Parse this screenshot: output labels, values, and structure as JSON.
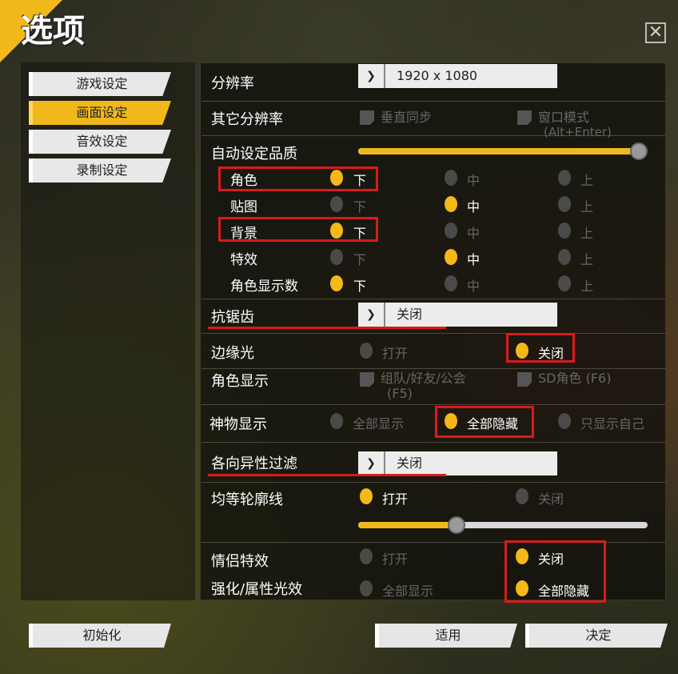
{
  "window": {
    "title": "选项"
  },
  "sidebar": {
    "items": [
      {
        "label": "游戏设定"
      },
      {
        "label": "画面设定"
      },
      {
        "label": "音效设定"
      },
      {
        "label": "录制设定"
      }
    ]
  },
  "settings": {
    "resolution": {
      "label": "分辨率",
      "value": "1920 x 1080"
    },
    "other_resolution": {
      "label": "其它分辨率",
      "vsync": "垂直同步",
      "window_mode": "窗口模式",
      "window_mode_hint": "(Alt+Enter)"
    },
    "auto_quality": {
      "label": "自动设定品质",
      "level": 0.97
    },
    "quality_rows": [
      {
        "label": "角色",
        "low": "下",
        "mid": "中",
        "high": "上",
        "selected": "low"
      },
      {
        "label": "贴图",
        "low": "下",
        "mid": "中",
        "high": "上",
        "selected": "mid"
      },
      {
        "label": "背景",
        "low": "下",
        "mid": "中",
        "high": "上",
        "selected": "low"
      },
      {
        "label": "特效",
        "low": "下",
        "mid": "中",
        "high": "上",
        "selected": "mid"
      },
      {
        "label": "角色显示数",
        "low": "下",
        "mid": "中",
        "high": "上",
        "selected": "low"
      }
    ],
    "antialias": {
      "label": "抗锯齿",
      "value": "关闭"
    },
    "rim_light": {
      "label": "边缘光",
      "on": "打开",
      "off": "关闭",
      "selected": "off"
    },
    "char_display": {
      "label": "角色显示",
      "opt1": "组队/好友/公会",
      "opt1_hint": "(F5)",
      "opt2": "SD角色 (F6)"
    },
    "artifact": {
      "label": "神物显示",
      "opt1": "全部显示",
      "opt2": "全部隐藏",
      "opt3": "只显示自己",
      "selected": "opt2"
    },
    "anisotropic": {
      "label": "各向异性过滤",
      "value": "关闭"
    },
    "outline": {
      "label": "均等轮廓线",
      "on": "打开",
      "off": "关闭",
      "selected": "on",
      "level": 0.34
    },
    "couple_fx": {
      "label": "情侣特效",
      "on": "打开",
      "off": "关闭",
      "selected": "off"
    },
    "enhance_fx": {
      "label": "强化/属性光效",
      "opt1": "全部显示",
      "opt2": "全部隐藏",
      "selected": "opt2"
    }
  },
  "footer": {
    "reset": "初始化",
    "apply": "适用",
    "confirm": "决定"
  },
  "colors": {
    "accent": "#f0b81a",
    "highlight": "#d81b1b"
  }
}
